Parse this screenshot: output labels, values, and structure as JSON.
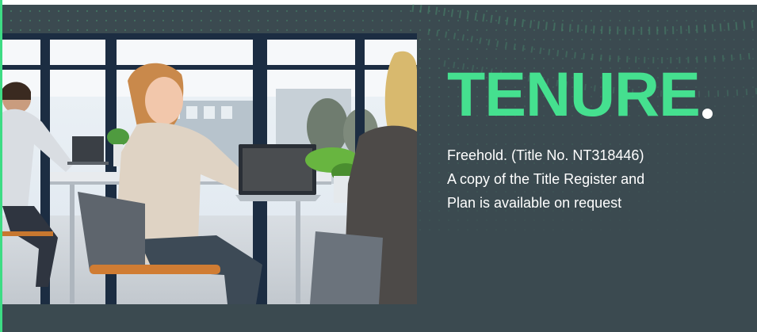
{
  "section": {
    "title": "TENURE",
    "lines": [
      "Freehold. (Title No. NT318446)",
      "A copy of the Title Register and",
      "Plan is available on request"
    ]
  },
  "colors": {
    "background": "#3b4a50",
    "title": "#45e08f",
    "accent": "#3ddc84",
    "text": "#ffffff"
  },
  "image": {
    "subject": "office-workers-with-laptops"
  }
}
